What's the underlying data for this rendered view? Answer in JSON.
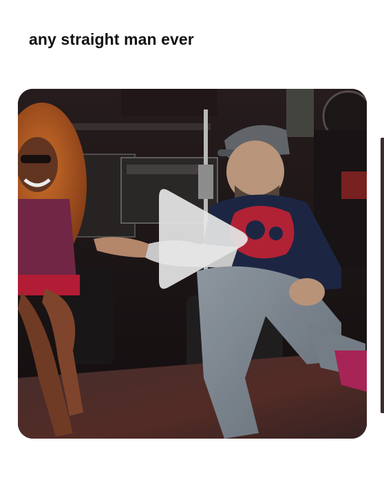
{
  "post": {
    "caption": "any straight man ever"
  },
  "video": {
    "state": "paused",
    "play_icon": "play-triangle-icon"
  },
  "colors": {
    "background": "#ffffff",
    "caption_text": "#111111",
    "play_overlay": "#e6e6e6"
  }
}
